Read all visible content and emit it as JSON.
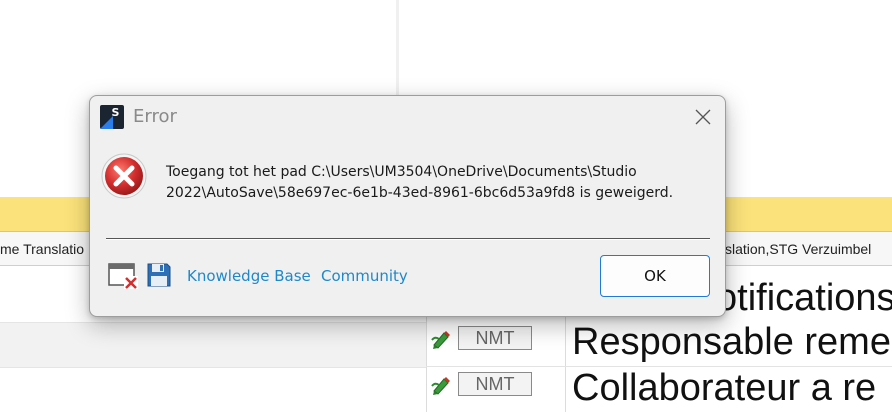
{
  "background": {
    "header_left": "me Translatio",
    "header_right": "slation,STG Verzuimbel",
    "top_text": "otifications",
    "rows": [
      {
        "status": "NMT",
        "text": "Responsable reme"
      },
      {
        "status": "NMT",
        "text": "Collaborateur a re"
      }
    ]
  },
  "dialog": {
    "title": "Error",
    "message": "Toegang tot het pad C:\\Users\\UM3504\\OneDrive\\Documents\\Studio 2022\\AutoSave\\58e697ec-6e1b-43ed-8961-6bc6d53a9fd8 is geweigerd.",
    "links": {
      "knowledge_base": "Knowledge Base",
      "community": "Community"
    },
    "ok_label": "OK"
  },
  "colors": {
    "accent": "#1e7bd6",
    "link": "#1e88c9",
    "error_red": "#d32f2f",
    "background_yellow": "#fbe27a"
  },
  "icons": [
    "app-icon",
    "close-icon",
    "error-icon",
    "knowledge-base-icon",
    "save-icon",
    "pen-icon"
  ]
}
